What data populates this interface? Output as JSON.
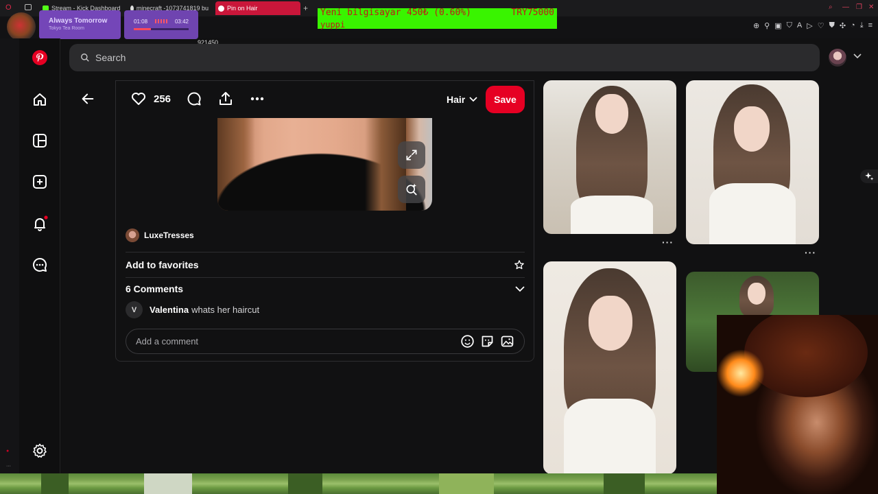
{
  "browser": {
    "tabs": [
      {
        "label": "Stream - Kick Dashboard",
        "icon": "kick-icon",
        "active": false
      },
      {
        "label": "minecraft -1073741819 bu",
        "icon": "github-icon",
        "active": false
      },
      {
        "label": "Pin on Hair",
        "icon": "pinterest-icon",
        "active": true
      }
    ],
    "address_fragment": "921450"
  },
  "overlay": {
    "ticker_line1_a": "Yeni bilgisayar",
    "ticker_line1_b": "450₺ (0.60%)",
    "ticker_line1_c": "TRY75000",
    "ticker_line2": "yuppi",
    "music_title": "Always Tomorrow",
    "music_artist": "Tokyo Tea Room",
    "time_elapsed": "01:08",
    "time_total": "03:42",
    "progress_fraction": 0.31
  },
  "search": {
    "placeholder": "Search"
  },
  "pin": {
    "likes": "256",
    "board": "Hair",
    "save_label": "Save",
    "creator": "LuxeTresses",
    "add_favorites": "Add to favorites",
    "comments_header": "6 Comments",
    "comment": {
      "initial": "V",
      "author": "Valentina",
      "text": "whats her haircut"
    },
    "add_comment_placeholder": "Add a comment"
  },
  "colors": {
    "accent": "#e60023",
    "ticker_bg": "#39f400",
    "ticker_text": "#c01818"
  }
}
